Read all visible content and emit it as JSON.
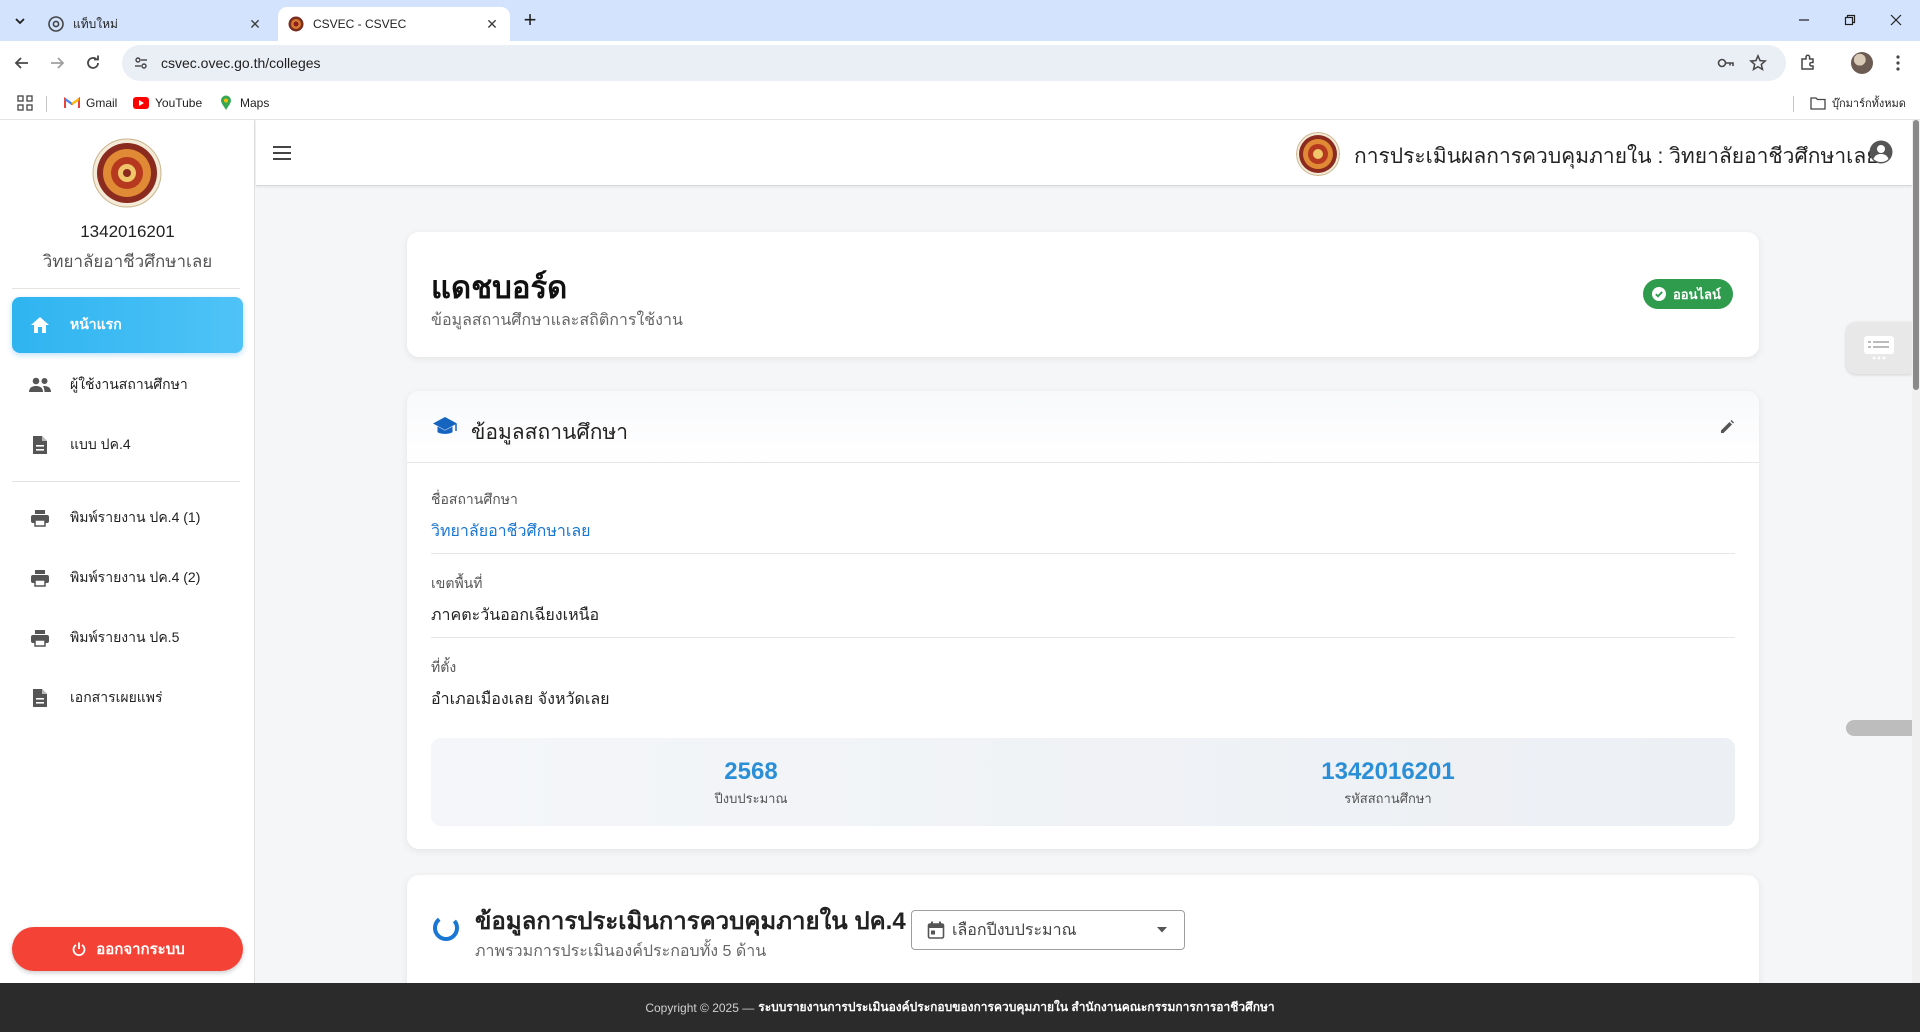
{
  "browser": {
    "tabs": [
      {
        "title": "แท็บใหม่",
        "active": false
      },
      {
        "title": "CSVEC - CSVEC",
        "active": true
      }
    ],
    "url": "csvec.ovec.go.th/colleges",
    "bookmarks": [
      {
        "label": "Gmail",
        "icon": "gmail-icon"
      },
      {
        "label": "YouTube",
        "icon": "youtube-icon"
      },
      {
        "label": "Maps",
        "icon": "maps-icon"
      }
    ],
    "all_bookmarks_label": "บุ๊กมาร์กทั้งหมด"
  },
  "sidebar": {
    "college_code": "1342016201",
    "college_name": "วิทยาลัยอาชีวศึกษาเลย",
    "items": [
      {
        "label": "หน้าแรก",
        "icon": "home-icon",
        "active": true
      },
      {
        "label": "ผู้ใช้งานสถานศึกษา",
        "icon": "users-icon",
        "active": false
      },
      {
        "label": "แบบ ปค.4",
        "icon": "document-icon",
        "active": false
      },
      {
        "label": "พิมพ์รายงาน ปค.4 (1)",
        "icon": "printer-icon",
        "active": false
      },
      {
        "label": "พิมพ์รายงาน ปค.4 (2)",
        "icon": "printer-icon",
        "active": false
      },
      {
        "label": "พิมพ์รายงาน ปค.5",
        "icon": "printer-icon",
        "active": false
      },
      {
        "label": "เอกสารเผยแพร่",
        "icon": "document-icon",
        "active": false
      }
    ],
    "logout_label": "ออกจากระบบ"
  },
  "appbar": {
    "title": "การประเมินผลการควบคุมภายใน : วิทยาลัยอาชีวศึกษาเลย"
  },
  "dashboard": {
    "title": "แดชบอร์ด",
    "subtitle": "ข้อมูลสถานศึกษาและสถิติการใช้งาน",
    "status": "ออนไลน์"
  },
  "school_info": {
    "title": "ข้อมูลสถานศึกษา",
    "fields": [
      {
        "label": "ชื่อสถานศึกษา",
        "value": "วิทยาลัยอาชีวศึกษาเลย"
      },
      {
        "label": "เขตพื้นที่",
        "value": "ภาคตะวันออกเฉียงเหนือ"
      },
      {
        "label": "ที่ตั้ง",
        "value": "อำเภอเมืองเลย จังหวัดเลย"
      }
    ],
    "stats": [
      {
        "value": "2568",
        "label": "ปีงบประมาณ"
      },
      {
        "value": "1342016201",
        "label": "รหัสสถานศึกษา"
      }
    ]
  },
  "evaluation": {
    "title": "ข้อมูลการประเมินการควบคุมภายใน ปค.4",
    "subtitle": "ภาพรวมการประเมินองค์ประกอบทั้ง 5 ด้าน",
    "year_select_placeholder": "เลือกปีงบประมาณ"
  },
  "footer": {
    "copyright": "Copyright © 2025 —",
    "system_name": "ระบบรายงานการประเมินองค์ประกอบของการควบคุมภายใน สำนักงานคณะกรรมการการอาชีวศึกษา"
  },
  "colors": {
    "primary": "#2fb4f0",
    "online": "#2e9b4d",
    "logout": "#f44336",
    "link": "#1976d2",
    "stat_value": "#2b8fd8"
  }
}
